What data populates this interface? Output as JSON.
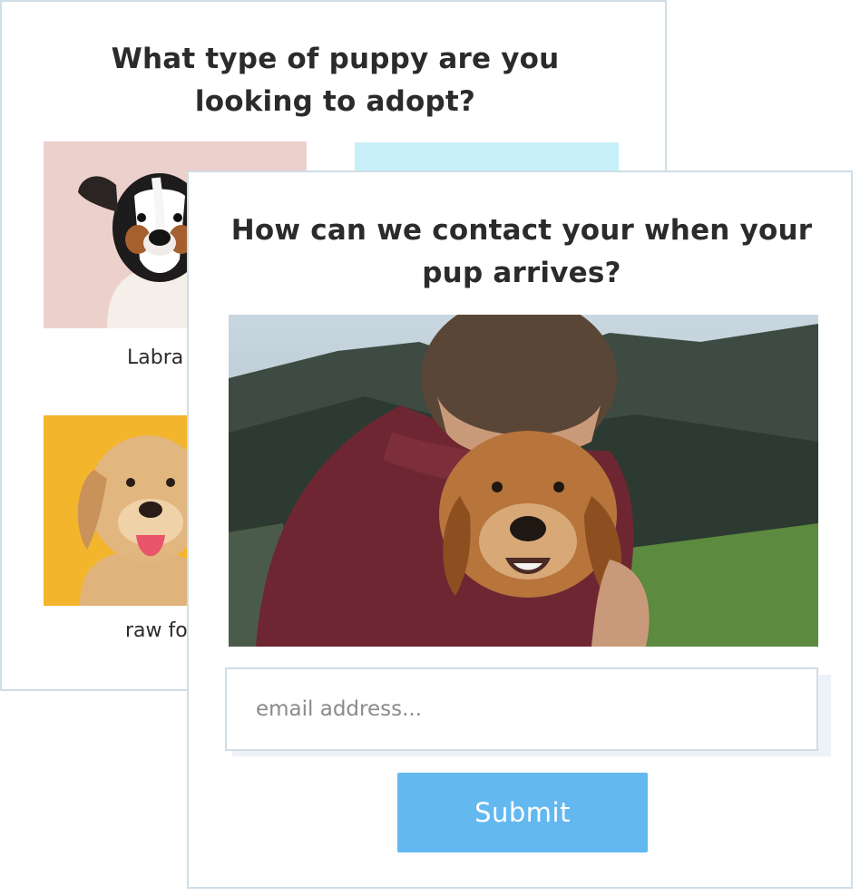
{
  "survey_step_1": {
    "question": "What type of puppy are you looking to adopt?",
    "options": [
      {
        "label": "Labra",
        "image": "terrier-puppy-photo"
      },
      {
        "label": "",
        "image": "light-blue-placeholder"
      },
      {
        "label": "raw fo",
        "image": "labrador-photo"
      }
    ]
  },
  "survey_step_2": {
    "question": "How can we contact your when your pup arrives?",
    "image": "man-hugging-dog-photo",
    "email_placeholder": "email address...",
    "submit_label": "Submit"
  },
  "colors": {
    "submit_button": "#63b8ef",
    "card_border": "#cfdde6",
    "tile_yellow": "#f3b52b",
    "tile_pink": "#ecd0cc",
    "tile_blue": "#c7eff7"
  }
}
